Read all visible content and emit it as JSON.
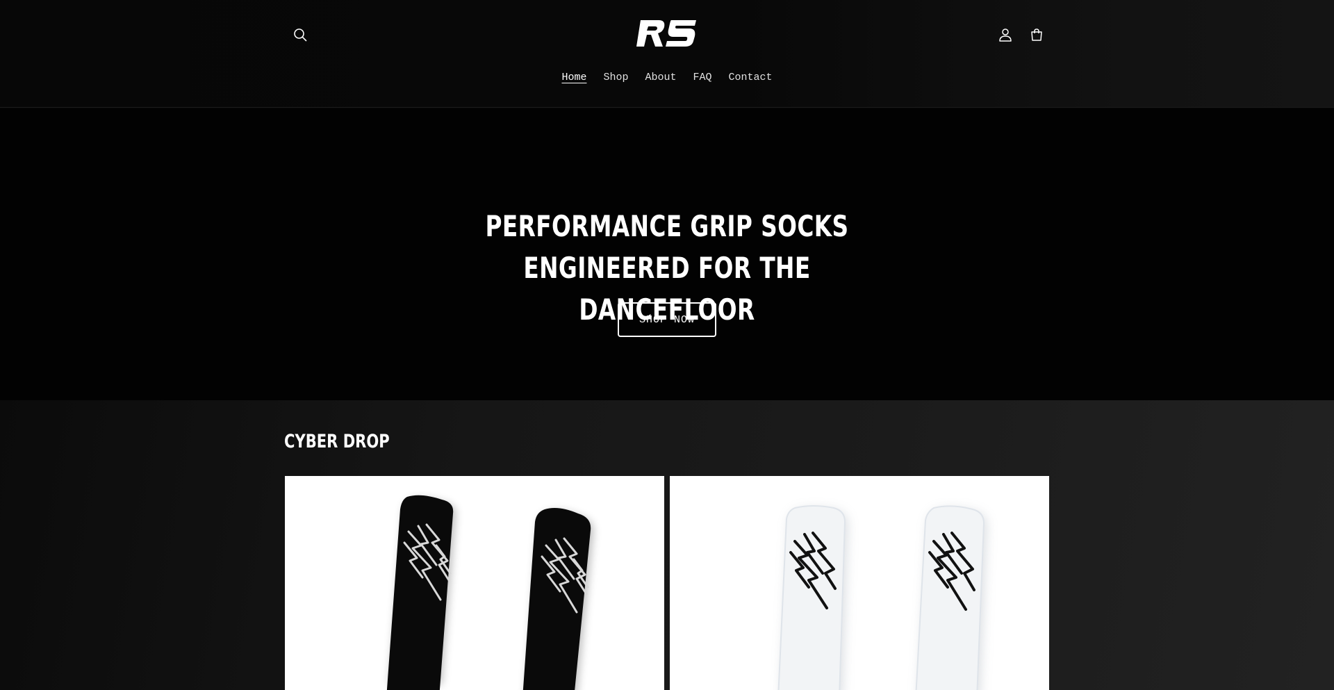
{
  "header": {
    "logo_text": "RS",
    "nav": [
      {
        "label": "Home",
        "active": true
      },
      {
        "label": "Shop",
        "active": false
      },
      {
        "label": "About",
        "active": false
      },
      {
        "label": "FAQ",
        "active": false
      },
      {
        "label": "Contact",
        "active": false
      }
    ],
    "icons": {
      "search": "search-icon",
      "account": "account-icon",
      "cart": "cart-icon"
    }
  },
  "hero": {
    "title_line1": "PERFORMANCE GRIP SOCKS ENGINEERED FOR THE",
    "title_line2": "DANCEFLOOR",
    "cta_label": "SHOP NOW"
  },
  "collection": {
    "title": "CYBER DROP",
    "products": [
      {
        "sock_color": "#0a0a0a",
        "pattern_color": "#d8d8d8"
      },
      {
        "sock_color": "#f2f4f6",
        "pattern_color": "#111111"
      }
    ]
  },
  "colors": {
    "background": "#060606",
    "text": "#ffffff",
    "card_background": "#ffffff"
  }
}
